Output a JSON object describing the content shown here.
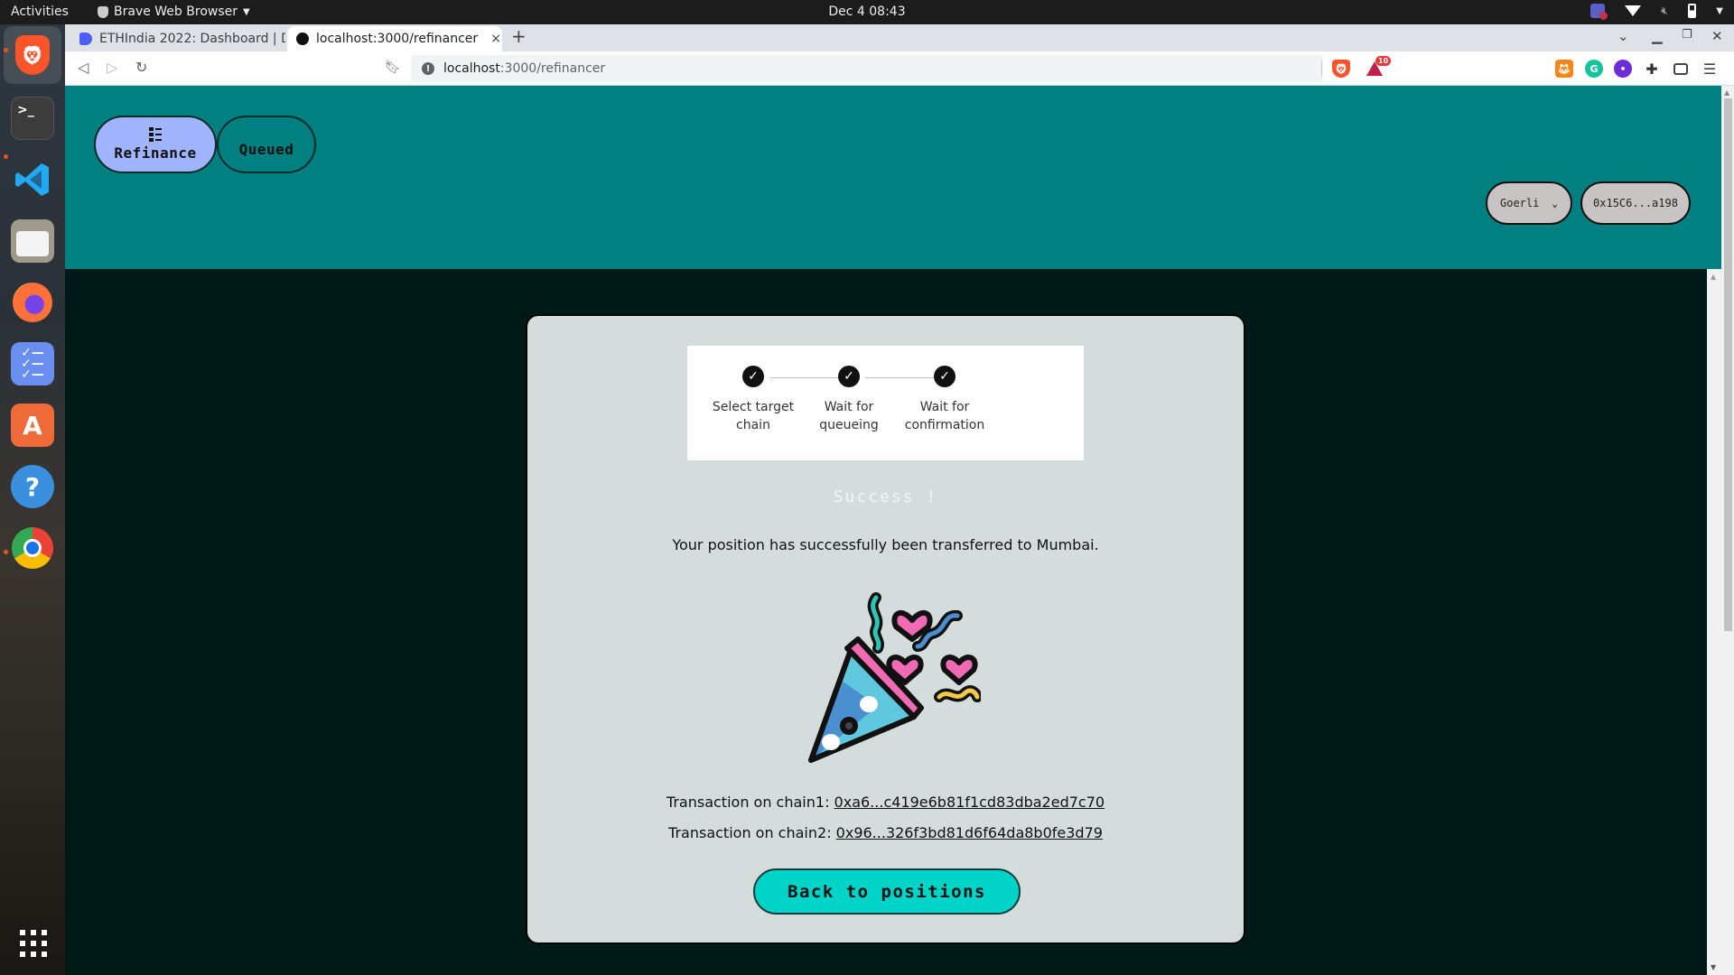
{
  "os": {
    "activities_label": "Activities",
    "app_menu_label": "Brave Web Browser",
    "clock": "Dec 4  08:43",
    "tray_icons": [
      "teams-notification-icon",
      "wifi-icon",
      "volume-muted-icon",
      "battery-icon",
      "system-menu-chevron-icon"
    ],
    "dock_items": [
      {
        "name": "brave",
        "label": "Brave"
      },
      {
        "name": "terminal",
        "label": ">_"
      },
      {
        "name": "vscode",
        "label": "VS Code"
      },
      {
        "name": "files",
        "label": "Files"
      },
      {
        "name": "firefox",
        "label": "Firefox"
      },
      {
        "name": "tasks",
        "label": "Tasks"
      },
      {
        "name": "software",
        "label": "A"
      },
      {
        "name": "help",
        "label": "?"
      },
      {
        "name": "chrome",
        "label": "Chrome"
      }
    ]
  },
  "browser": {
    "tabs": [
      {
        "title": "ETHIndia 2022: Dashboard | D",
        "active": false,
        "favicon_color": "#4c5cf5"
      },
      {
        "title": "localhost:3000/refinancer",
        "active": true,
        "favicon_color": "#111111"
      }
    ],
    "new_tab_label": "+",
    "close_tab_label": "×",
    "url_host": "localhost",
    "url_path": ":3000/refinancer",
    "brave_rewards_badge": "10"
  },
  "app": {
    "nav": {
      "refinance_label": "Refinance",
      "queued_label": "Queued"
    },
    "network_select": {
      "selected": "Goerli"
    },
    "wallet_address": "0x15C6...a198",
    "stepper": {
      "steps": [
        {
          "label_line1": "Select target",
          "label_line2": "chain",
          "completed": true
        },
        {
          "label_line1": "Wait for",
          "label_line2": "queueing",
          "completed": true
        },
        {
          "label_line1": "Wait for",
          "label_line2": "confirmation",
          "completed": true
        }
      ],
      "check_glyph": "✓"
    },
    "success_title": "Success !",
    "success_message": "Your position has successfully been transferred to Mumbai.",
    "transactions": [
      {
        "label": "Transaction on chain1: ",
        "hash": "0xa6...c419e6b81f1cd83dba2ed7c70"
      },
      {
        "label": "Transaction on chain2: ",
        "hash": "0x96...326f3bd81d6f64da8b0fe3d79"
      }
    ],
    "back_button_label": "Back to positions",
    "colors": {
      "header_bg": "#008080",
      "page_bg": "#001a17",
      "active_nav": "#a0b4ff",
      "card_bg": "#d5dcdc",
      "primary_button": "#00d4c8"
    }
  }
}
